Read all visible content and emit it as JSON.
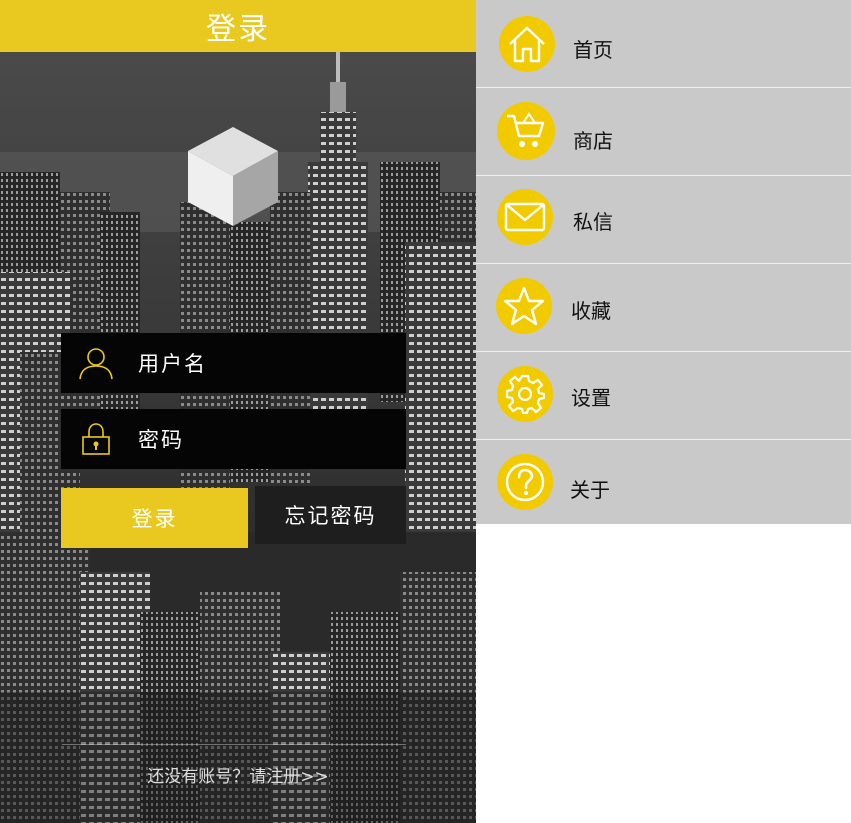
{
  "login": {
    "title": "登录",
    "username_placeholder": "用户名",
    "password_placeholder": "密码",
    "login_button": "登录",
    "forgot_button": "忘记密码",
    "register_link": "还没有账号？请注册>>"
  },
  "menu": {
    "items": [
      {
        "label": "首页",
        "icon": "home-icon"
      },
      {
        "label": "商店",
        "icon": "cart-icon"
      },
      {
        "label": "私信",
        "icon": "mail-icon"
      },
      {
        "label": "收藏",
        "icon": "star-icon"
      },
      {
        "label": "设置",
        "icon": "gear-icon"
      },
      {
        "label": "关于",
        "icon": "help-icon"
      }
    ]
  },
  "colors": {
    "accent": "#e9c91f",
    "menu_bg": "#c9c9c9",
    "field_bg": "#050505"
  }
}
